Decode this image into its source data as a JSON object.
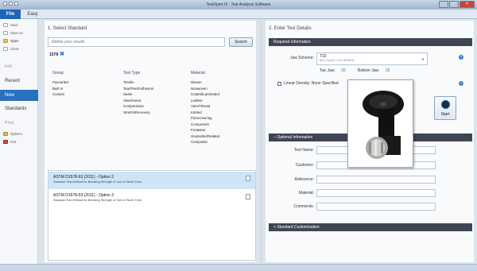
{
  "window": {
    "title": "TestXpert III · Test Analysis Software"
  },
  "ribbon": {
    "tabs": [
      "File",
      "Easy"
    ]
  },
  "left_menu": {
    "small_items": [
      "Save",
      "Save As",
      "Open",
      "Close"
    ],
    "info": "Info",
    "big_items": [
      "Recent",
      "New",
      "Standards",
      "Print"
    ],
    "bottom_items": [
      "Options",
      "Exit"
    ]
  },
  "select_standard": {
    "title": "1. Select Standard",
    "search_placeholder": "Refine your results",
    "search_button": "Search",
    "filter_tag": "1578",
    "columns": {
      "group": {
        "header": "Group",
        "items": [
          "Favourites",
          "Built in",
          "Custom"
        ]
      },
      "test_type": {
        "header": "Test Type",
        "items": [
          "Tensile",
          "Tear/Peel/Adhesion",
          "Seam",
          "Attachment",
          "Compression",
          "Stretch/Recovery"
        ]
      },
      "material": {
        "header": "Material",
        "items": [
          "Woven",
          "Nonwoven",
          "Coated/Laminated",
          "Leather",
          "Yarn/Thread",
          "Knitted",
          "Floorcovering",
          "Component",
          "Footwear",
          "Geotextile/Related",
          "Composite"
        ]
      }
    },
    "results": [
      {
        "title": "ASTM D1578-93 (2011) - Option 2",
        "desc": "Standard Test Method for Breaking Strength of Yarn in Skein Form"
      },
      {
        "title": "ASTM D1578-93 (2011) - Option 3",
        "desc": "Standard Test Method for Breaking Strength of Yarn in Skein Form"
      }
    ]
  },
  "test_details": {
    "title": "2. Enter Test Details",
    "required_header": "Required Information",
    "jaw_scheme_label": "Jaw Scheme:",
    "jaw_scheme_value": "T32",
    "jaw_scheme_sub": "Bent Spade / Horn Bollards",
    "top_jaw_label": "Top Jaw:",
    "top_jaw_value": "35",
    "bottom_jaw_label": "Bottom Jaw:",
    "bottom_jaw_value": "35",
    "linear_density_label": "Linear Density: None Specified",
    "start_label": "Start",
    "optional_header": "Optional Information",
    "optional_fields": [
      "Test Name:",
      "Customer:",
      "Reference:",
      "Material:",
      "Comments:"
    ],
    "custom_header": "Standard Customisation"
  },
  "colors": {
    "accent": "#2a70bd",
    "section_bar": "#3d4652",
    "selected_row": "#cfe4f7"
  }
}
